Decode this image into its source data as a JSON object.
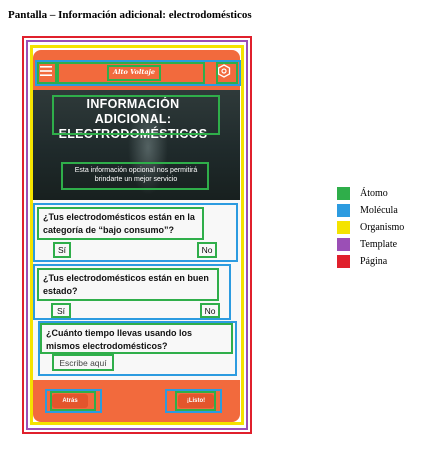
{
  "title": "Pantalla – Información adicional: electrodomésticos",
  "app": {
    "logo_text": "Alto Voltaje",
    "menu_icon": "hamburger-menu-icon",
    "settings_icon": "hexagon-settings-icon"
  },
  "hero": {
    "title": "INFORMACIÓN ADICIONAL:\nELECTRODOMÉSTICOS",
    "subtitle": "Esta información opcional nos permitirá brindarte un mejor servicio"
  },
  "questions": [
    {
      "text": "¿Tus electrodomésticos están en la categoría de “bajo consumo”?",
      "yes": "Sí",
      "no": "No"
    },
    {
      "text": "¿Tus electrodomésticos están en buen estado?",
      "yes": "Sí",
      "no": "No"
    },
    {
      "text": "¿Cuánto tiempo llevas usando los mismos electrodomésticos?",
      "placeholder": "Escribe aquí"
    }
  ],
  "footer": {
    "back_label": "Atrás",
    "done_label": "¡Listo!"
  },
  "legend": [
    {
      "label": "Átomo",
      "color": "#2fae4a"
    },
    {
      "label": "Molécula",
      "color": "#2c9be0"
    },
    {
      "label": "Organismo",
      "color": "#f4e300"
    },
    {
      "label": "Template",
      "color": "#9b4fb6"
    },
    {
      "label": "Página",
      "color": "#e0202c"
    }
  ]
}
